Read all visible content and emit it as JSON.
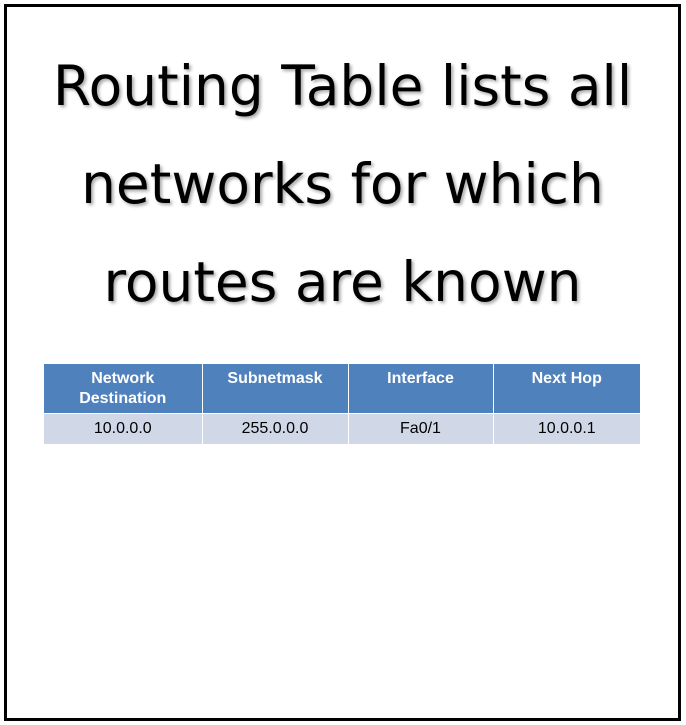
{
  "slide": {
    "title_lines": [
      "Routing Table lists all",
      "networks for which",
      "routes are known"
    ]
  },
  "routing_table": {
    "headers": [
      "Network Destination",
      "Subnetmask",
      "Interface",
      "Next Hop"
    ],
    "rows": [
      [
        "10.0.0.0",
        "255.0.0.0",
        "Fa0/1",
        "10.0.0.1"
      ]
    ]
  },
  "colors": {
    "header_bg": "#4f81bd",
    "row_bg": "#d0d8e8",
    "frame": "#000000"
  }
}
